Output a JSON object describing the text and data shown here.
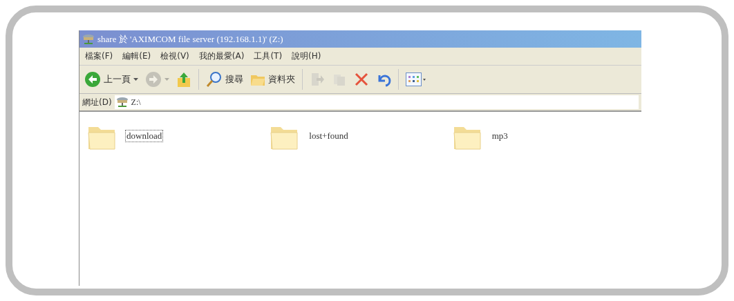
{
  "window": {
    "title": "share 於 'AXIMCOM file server (192.168.1.1)' (Z:)"
  },
  "menu": [
    {
      "label": "檔案(F)"
    },
    {
      "label": "編輯(E)"
    },
    {
      "label": "檢視(V)"
    },
    {
      "label": "我的最愛(A)"
    },
    {
      "label": "工具(T)"
    },
    {
      "label": "說明(H)"
    }
  ],
  "toolbar": [
    {
      "kind": "back",
      "label": "上一頁",
      "disabled": false
    },
    {
      "kind": "forward",
      "disabled": true
    },
    {
      "kind": "up",
      "disabled": false
    },
    {
      "kind": "search",
      "label": "搜尋",
      "disabled": false
    },
    {
      "kind": "folders",
      "label": "資料夾",
      "disabled": false
    },
    {
      "kind": "move",
      "disabled": true
    },
    {
      "kind": "copy",
      "disabled": true
    },
    {
      "kind": "delete",
      "disabled": false
    },
    {
      "kind": "undo",
      "disabled": false
    },
    {
      "kind": "views",
      "disabled": false
    }
  ],
  "address": {
    "label": "網址(D)",
    "value": "Z:\\"
  },
  "items": [
    {
      "name": "download",
      "selected": true
    },
    {
      "name": "lost+found",
      "selected": false
    },
    {
      "name": "mp3",
      "selected": false
    }
  ]
}
